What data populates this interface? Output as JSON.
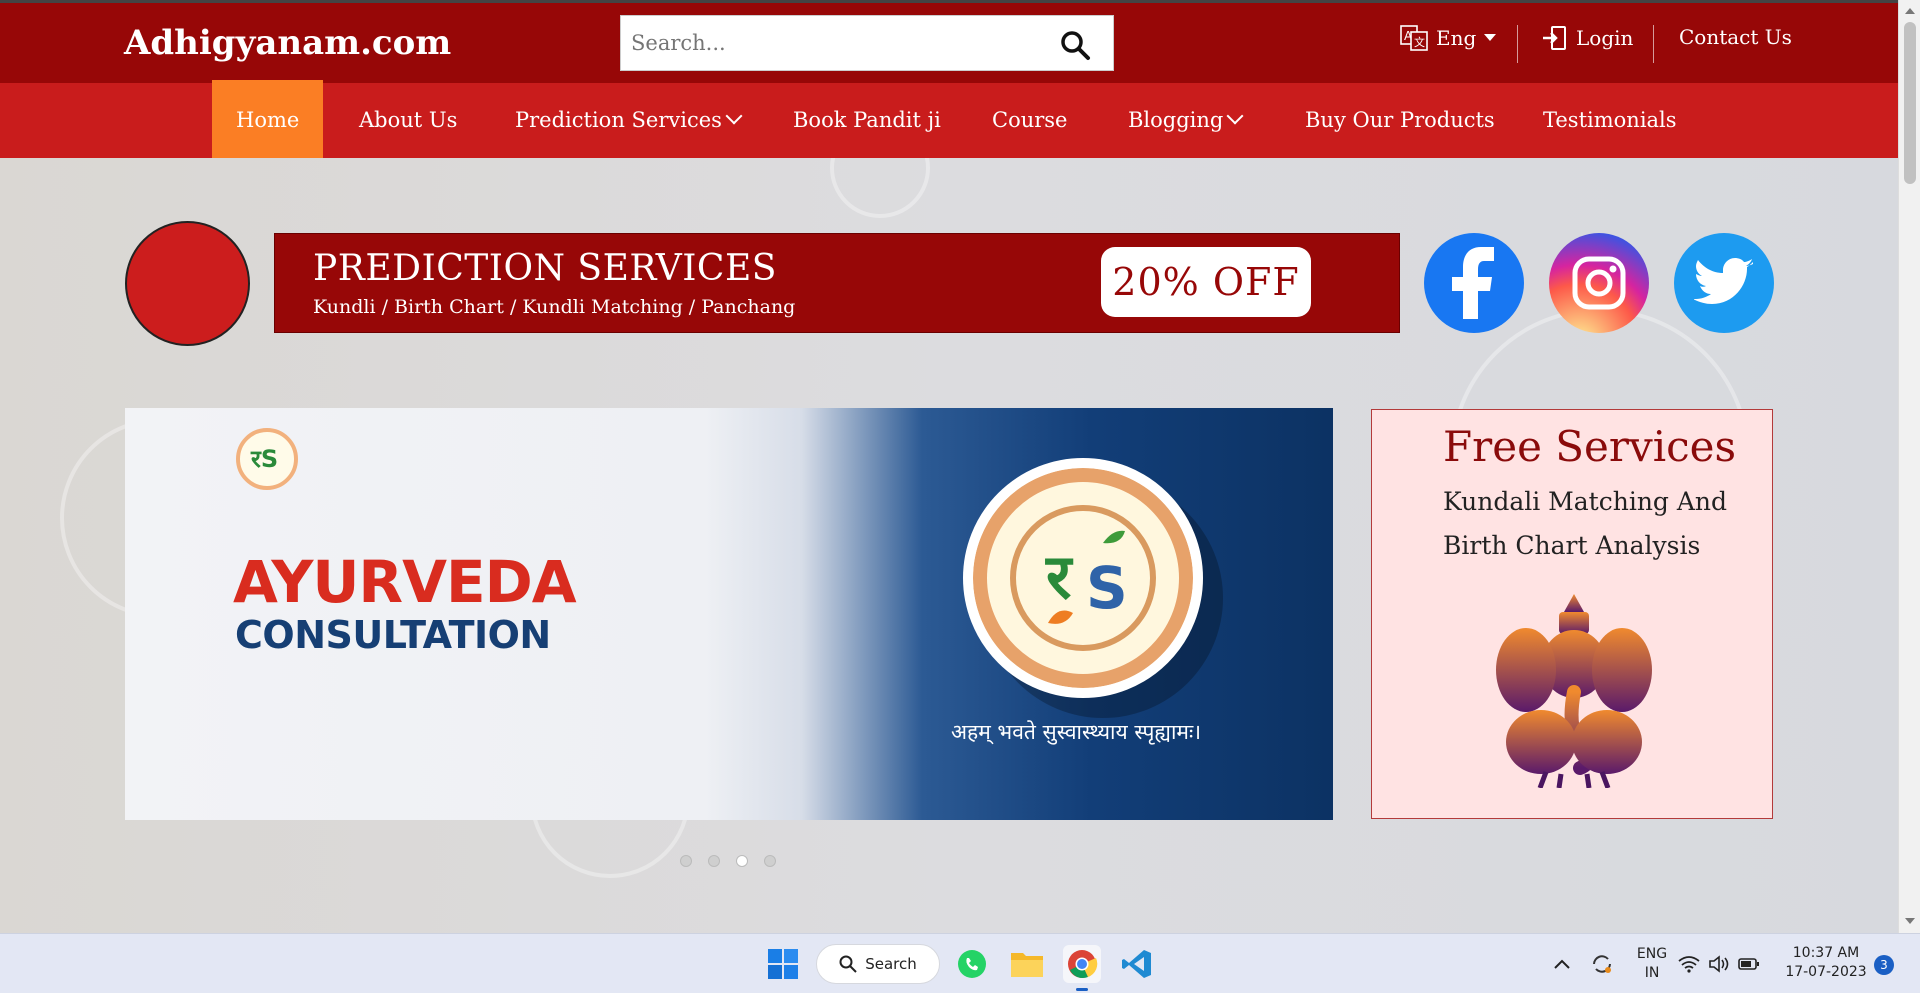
{
  "header": {
    "brand": "Adhigyanam.com",
    "search_placeholder": "Search...",
    "language_label": "Eng",
    "login_label": "Login",
    "contact_label": "Contact Us"
  },
  "nav": {
    "items": [
      {
        "label": "Home",
        "active": true
      },
      {
        "label": "About Us"
      },
      {
        "label": "Prediction Services",
        "dropdown": true
      },
      {
        "label": "Book Pandit ji"
      },
      {
        "label": "Course"
      },
      {
        "label": "Blogging",
        "dropdown": true
      },
      {
        "label": "Buy Our Products"
      },
      {
        "label": "Testimonials"
      }
    ]
  },
  "banner": {
    "title": "PREDICTION SERVICES",
    "subtitle": "Kundli / Birth Chart / Kundli Matching / Panchang",
    "offer": "20% OFF"
  },
  "social": [
    "facebook-icon",
    "instagram-icon",
    "twitter-icon"
  ],
  "slider": {
    "headline": "AYURVEDA",
    "subheadline": "CONSULTATION",
    "tagline": "अहम् भवते सुस्वास्थ्याय स्पृह्यामः।",
    "dot_count": 4,
    "active_dot": 3
  },
  "free_services": {
    "title": "Free Services",
    "subtitle": "Kundali Matching And Birth Chart Analysis"
  },
  "taskbar": {
    "search_label": "Search",
    "lang_top": "ENG",
    "lang_bottom": "IN",
    "time": "10:37 AM",
    "date": "17-07-2023",
    "notifications": "3"
  },
  "colors": {
    "header": "#970707",
    "nav": "#c91c1c",
    "active_nav": "#fb7e24"
  }
}
